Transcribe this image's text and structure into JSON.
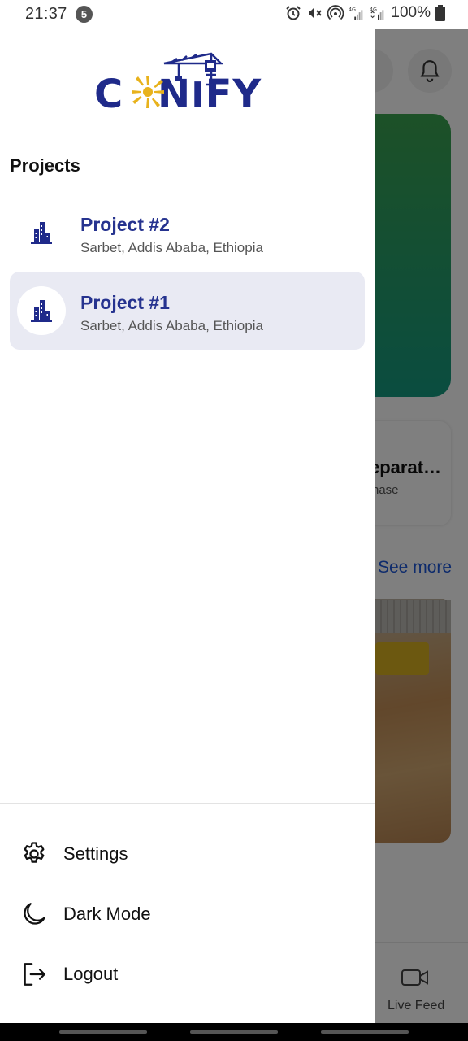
{
  "status_bar": {
    "time": "21:37",
    "notification_count": "5",
    "battery": "100%"
  },
  "app": {
    "logo_text": "CONIFY",
    "brand_color": "#1f2a8a",
    "accent_color": "#e8b21c"
  },
  "drawer": {
    "projects_heading": "Projects",
    "projects": [
      {
        "name": "Project #2",
        "location": "Sarbet, Addis Ababa, Ethiopia",
        "selected": false
      },
      {
        "name": "Project #1",
        "location": "Sarbet, Addis Ababa, Ethiopia",
        "selected": true
      }
    ],
    "menu": [
      {
        "label": "Settings",
        "icon": "gear-icon"
      },
      {
        "label": "Dark Mode",
        "icon": "moon-icon"
      },
      {
        "label": "Logout",
        "icon": "logout-icon"
      }
    ]
  },
  "background": {
    "card_title": "eparat…",
    "card_subtitle": "hase",
    "see_more": "See more",
    "nav_live_feed": "Live Feed"
  }
}
